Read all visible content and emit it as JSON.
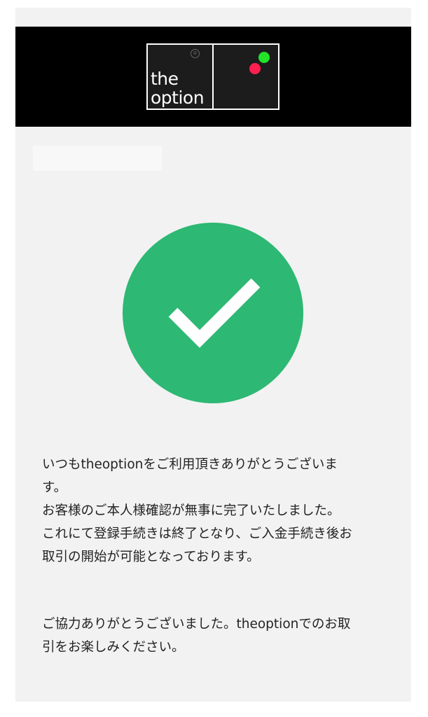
{
  "logo": {
    "line1": "the",
    "line2": "option",
    "reg_mark": "①"
  },
  "colors": {
    "header_bg": "#000000",
    "page_bg": "#f2f2f2",
    "success_green": "#2db873",
    "logo_red_dot": "#ff1f4f",
    "logo_green_dot": "#22e328"
  },
  "icons": {
    "status": "check-icon"
  },
  "message": {
    "line1": "いつもtheoptionをご利用頂きありがとうございま",
    "line2": "す。",
    "line3": "お客様のご本人様確認が無事に完了いたしました。",
    "line4": "これにて登録手続きは終了となり、ご入金手続き後お",
    "line5": "取引の開始が可能となっております。"
  },
  "closing": {
    "line1": "ご協力ありがとうございました。theoptionでのお取",
    "line2": "引をお楽しみください。"
  }
}
